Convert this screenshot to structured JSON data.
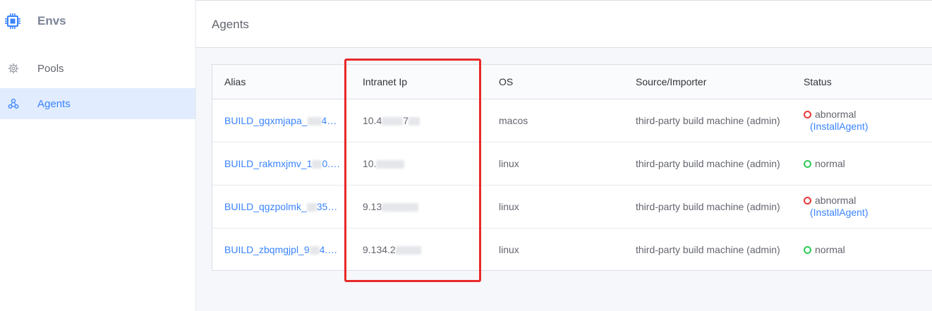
{
  "sidebar": {
    "title": "Envs",
    "items": [
      {
        "label": "Pools",
        "icon": "gear-cluster-icon",
        "active": false
      },
      {
        "label": "Agents",
        "icon": "network-nodes-icon",
        "active": true
      }
    ]
  },
  "header": {
    "title": "Agents"
  },
  "table": {
    "columns": [
      "Alias",
      "Intranet Ip",
      "OS",
      "Source/Importer",
      "Status"
    ],
    "rows": [
      {
        "alias": "BUILD_gqxmjapa_",
        "alias_tail": "4…",
        "ip": "10.4",
        "ip_tail": "7",
        "os": "macos",
        "source": "third-party build machine (admin)",
        "status": "abnormal",
        "action": "(InstallAgent)"
      },
      {
        "alias": "BUILD_rakmxjmv_1",
        "alias_tail": "0.…",
        "ip": "10.",
        "ip_tail": "",
        "os": "linux",
        "source": "third-party build machine (admin)",
        "status": "normal",
        "action": ""
      },
      {
        "alias": "BUILD_qgzpolmk_",
        "alias_tail": "35…",
        "ip": "9.13",
        "ip_tail": "",
        "os": "linux",
        "source": "third-party build machine (admin)",
        "status": "abnormal",
        "action": "(InstallAgent)"
      },
      {
        "alias": "BUILD_zbqmgjpl_9",
        "alias_tail": "4.…",
        "ip": "9.134.2",
        "ip_tail": "",
        "os": "linux",
        "source": "third-party build machine (admin)",
        "status": "normal",
        "action": ""
      }
    ]
  },
  "colors": {
    "accent": "#3a84ff",
    "highlight": "#e8292a",
    "abnormal": "#ea3636",
    "normal": "#2dcb56"
  }
}
